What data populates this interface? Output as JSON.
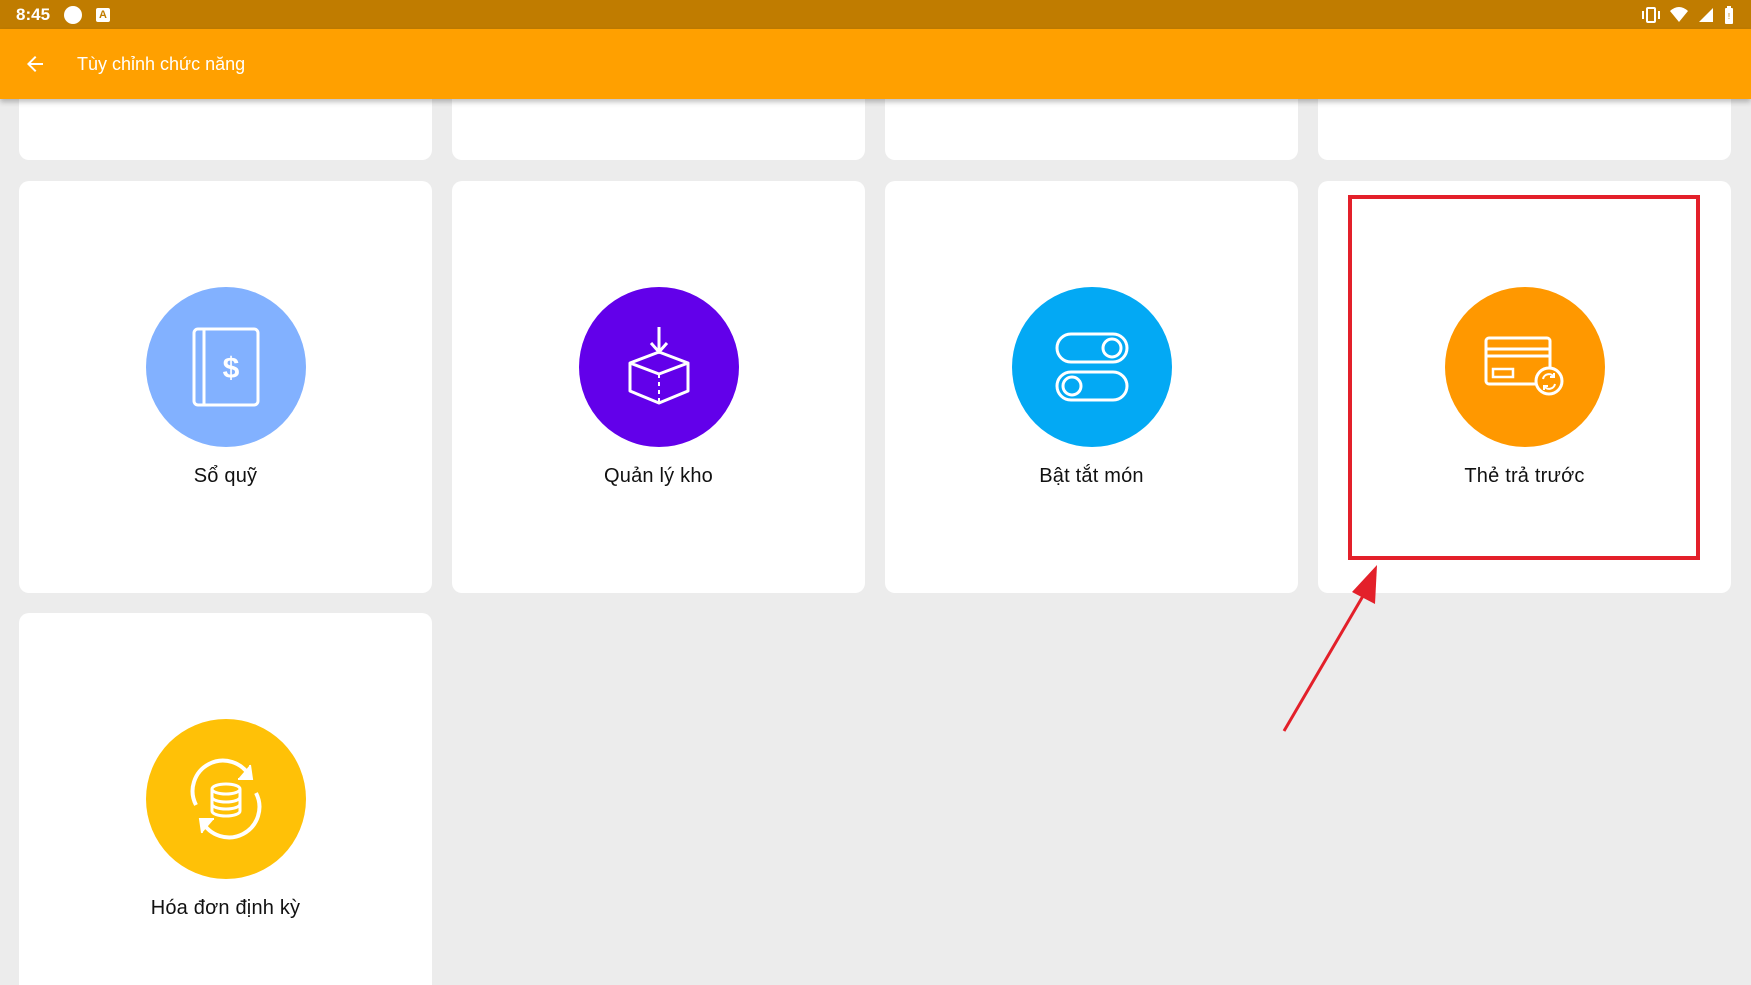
{
  "status_bar": {
    "time": "8:45",
    "icons": [
      "notification-dot-icon",
      "android-a-icon",
      "vibrate-icon",
      "wifi-icon",
      "signal-icon",
      "battery-icon"
    ]
  },
  "app_bar": {
    "title": "Tùy chỉnh chức năng",
    "back_icon": "arrow-left-icon",
    "color": "#ffa000"
  },
  "functions": [
    {
      "label": "Sổ quỹ",
      "icon": "cash-book-icon",
      "color": "#82b1ff"
    },
    {
      "label": "Quản lý kho",
      "icon": "warehouse-box-icon",
      "color": "#6200ea"
    },
    {
      "label": "Bật tắt món",
      "icon": "toggle-switch-icon",
      "color": "#03a9f4"
    },
    {
      "label": "Thẻ trả trước",
      "icon": "prepaid-card-icon",
      "color": "#ff9800"
    },
    {
      "label": "Hóa đơn định kỳ",
      "icon": "recurring-invoice-icon",
      "color": "#ffc107"
    }
  ],
  "annotation": {
    "highlight_color": "#e3202a",
    "highlighted_item": "Thẻ trả trước"
  }
}
